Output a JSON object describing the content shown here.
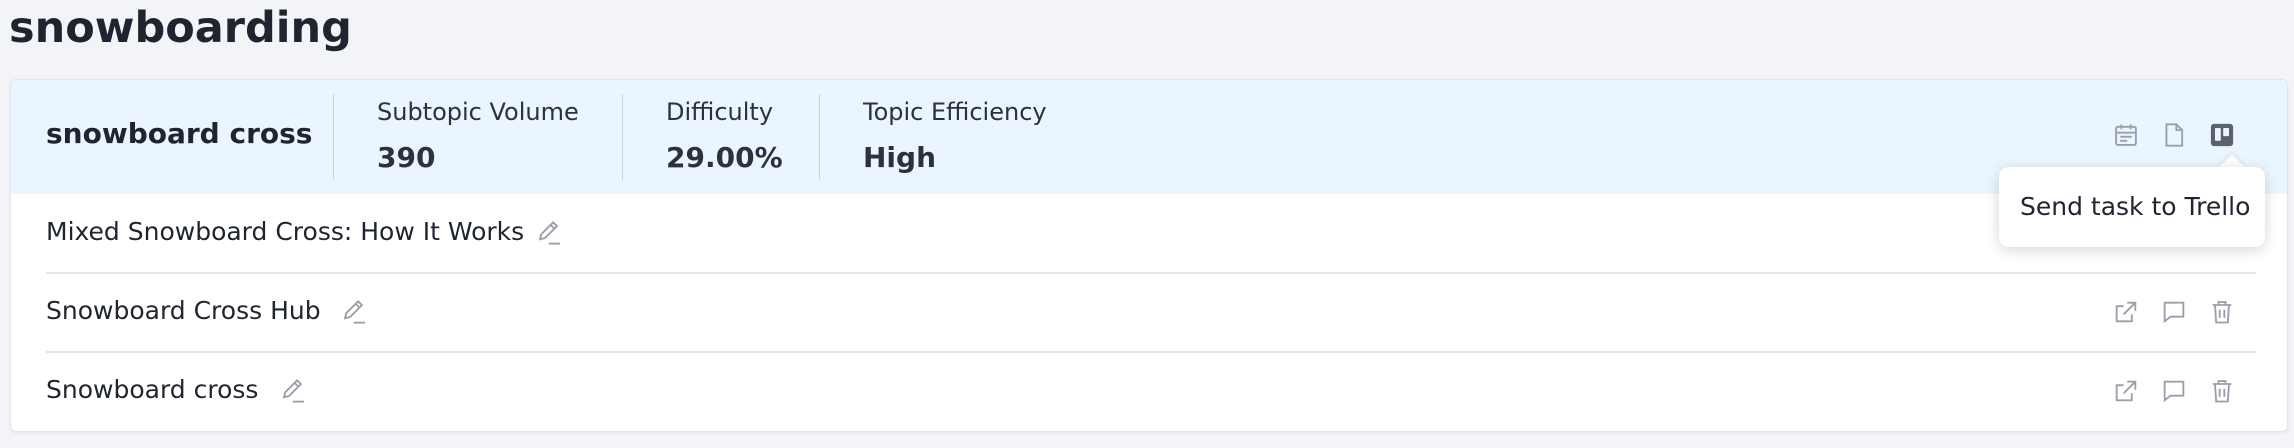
{
  "page": {
    "title": "snowboarding"
  },
  "topic": {
    "name": "snowboard cross",
    "metrics": [
      {
        "label": "Subtopic Volume",
        "value": "390"
      },
      {
        "label": "Difficulty",
        "value": "29.00%"
      },
      {
        "label": "Topic Efficiency",
        "value": "High"
      }
    ],
    "header_icons": [
      "calendar-icon",
      "document-icon",
      "trello-icon"
    ]
  },
  "tooltip": {
    "text": "Send task to Trello"
  },
  "rows": [
    {
      "title": "Mixed Snowboard Cross: How It Works"
    },
    {
      "title": "Snowboard Cross Hub"
    },
    {
      "title": "Snowboard cross"
    }
  ],
  "row_icons": [
    "external-link-icon",
    "comment-icon",
    "trash-icon"
  ],
  "colors": {
    "header_bg": "#eaf5fd",
    "icon_gray": "#9aa0aa",
    "icon_active": "#5a6270",
    "text": "#1f2430"
  }
}
